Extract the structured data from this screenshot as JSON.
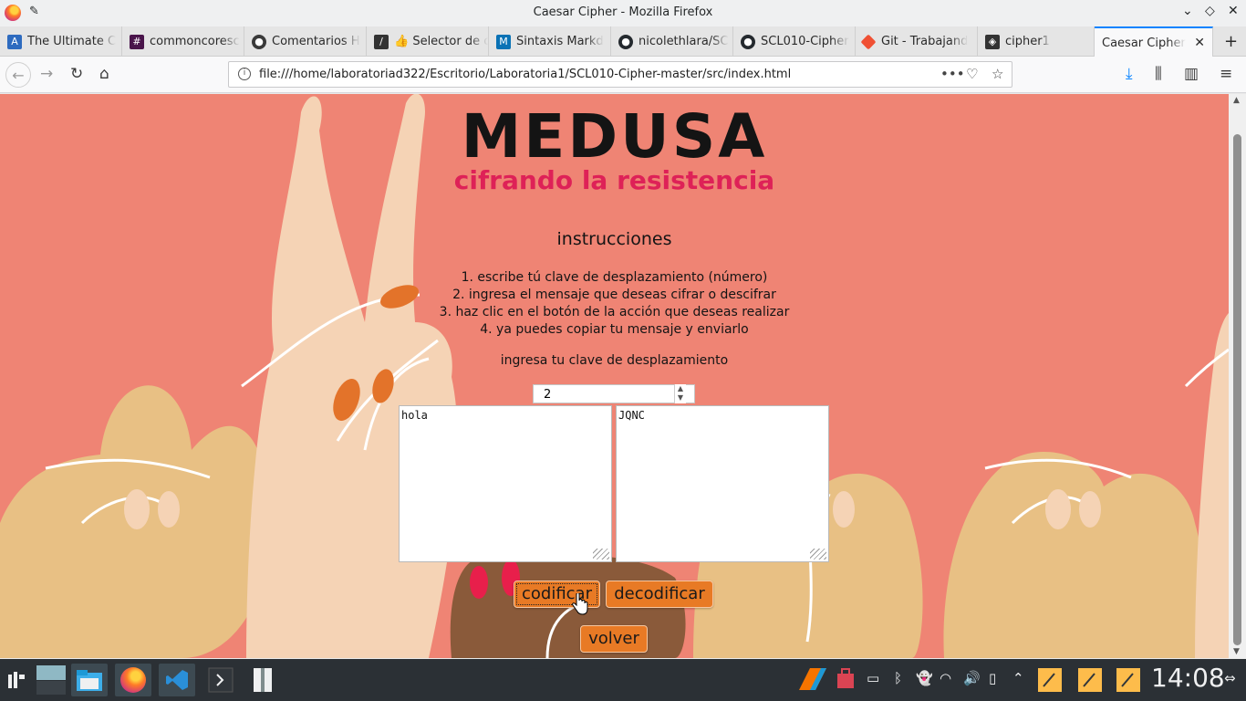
{
  "window": {
    "title": "Caesar Cipher - Mozilla Firefox"
  },
  "tabs": [
    {
      "label": "The Ultimate C",
      "icon": "A",
      "color": "#2e6bbf"
    },
    {
      "label": "commoncoresc",
      "icon": "#",
      "color": "#4a154b"
    },
    {
      "label": "Comentarios H",
      "icon": "●",
      "color": "#3a3a3a"
    },
    {
      "label": "👍 Selector de c",
      "icon": "/",
      "color": "#333"
    },
    {
      "label": "Sintaxis Markd",
      "icon": "M",
      "color": "#0a72b5"
    },
    {
      "label": "nicolethlara/SC",
      "icon": "●",
      "color": "#24292e"
    },
    {
      "label": "SCL010-Cipher",
      "icon": "●",
      "color": "#24292e"
    },
    {
      "label": "Git - Trabajand",
      "icon": "◆",
      "color": "#f05033"
    },
    {
      "label": "cipher1",
      "icon": "◈",
      "color": "#333"
    },
    {
      "label": "Caesar Cipher",
      "icon": "",
      "color": ""
    }
  ],
  "navbar": {
    "url": "file:///home/laboratoriad322/Escritorio/Laboratoria1/SCL010-Cipher-master/src/index.html"
  },
  "page": {
    "heading": "MEDUSA",
    "subheading": "cifrando la resistencia",
    "instructions_title": "instrucciones",
    "steps": [
      "1. escribe tú clave de desplazamiento (número)",
      "2. ingresa el mensaje que deseas cifrar o descifrar",
      "3. haz clic en el botón de la acción que deseas realizar",
      "4. ya puedes copiar tu mensaje y enviarlo"
    ],
    "key_label": "ingresa tu clave de desplazamiento",
    "key_value": "2",
    "input_text": "hola",
    "output_text": "JQNC",
    "encode_label": "codificar",
    "decode_label": "decodificar",
    "back_label": "volver"
  },
  "taskbar": {
    "clock": "14:08"
  },
  "colors": {
    "page_bg": "#ef8474",
    "accent_pink": "#de2157",
    "button_orange": "#e87a25"
  }
}
